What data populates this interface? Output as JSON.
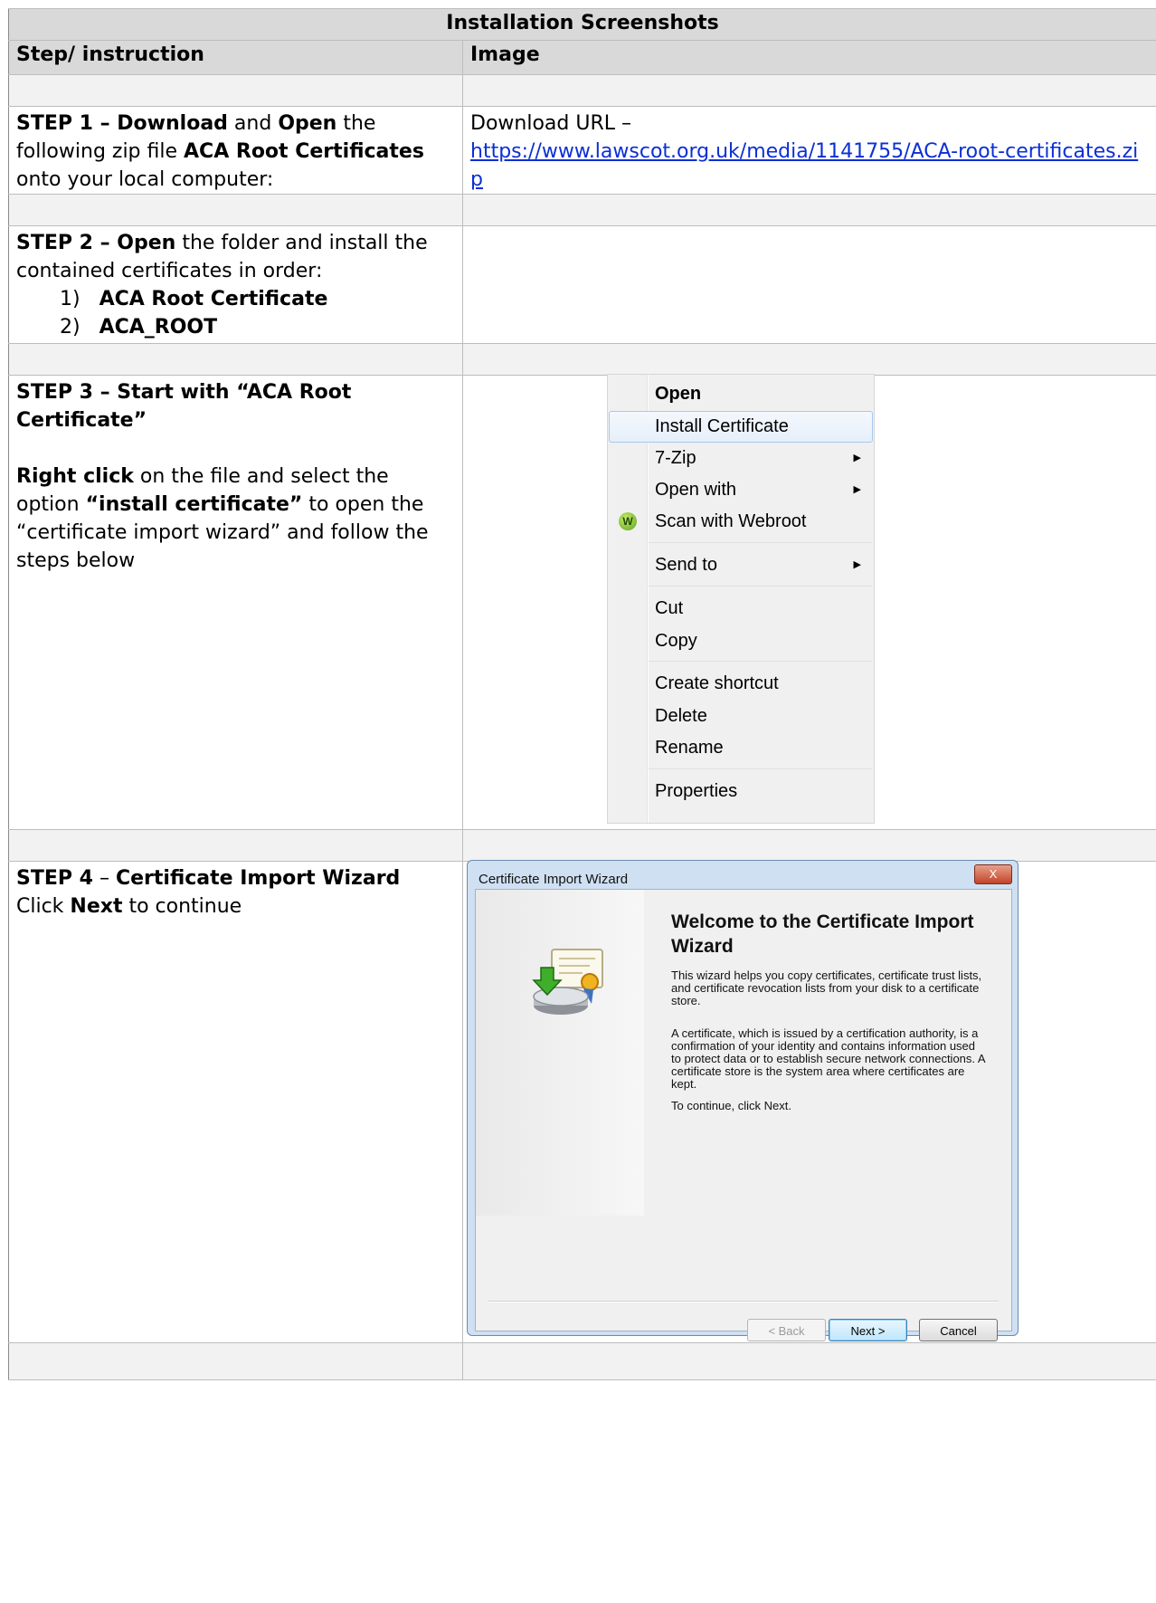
{
  "table": {
    "title": "Installation Screenshots",
    "col_step": "Step/ instruction",
    "col_image": "Image"
  },
  "step1": {
    "label": "STEP 1 – ",
    "download": "Download",
    "and": " and ",
    "open": "Open",
    "text1": " the following zip file ",
    "file": "ACA Root Certificates",
    "text2": " onto your local computer:",
    "url_label": "Download URL –",
    "url": "https://www.lawscot.org.uk/media/1141755/ACA-root-certificates.zip"
  },
  "step2": {
    "label": "STEP 2 – ",
    "open": "Open",
    "text": " the folder and install the contained certificates in order:",
    "items": [
      {
        "num": "1)",
        "name": "ACA Root Certificate"
      },
      {
        "num": "2)",
        "name": "ACA_ROOT"
      }
    ]
  },
  "step3": {
    "heading": "STEP 3 – Start with “ACA Root Certificate”",
    "right_click": "Right click",
    "text1": " on the file and select the option ",
    "option": "“install certificate”",
    "text2": " to open the “certificate import wizard” and follow the steps below"
  },
  "context_menu": {
    "items": [
      "Open",
      "Install Certificate",
      "7-Zip",
      "Open with",
      "Scan with Webroot",
      "Send to",
      "Cut",
      "Copy",
      "Create shortcut",
      "Delete",
      "Rename",
      "Properties"
    ],
    "webroot_icon": "W"
  },
  "step4": {
    "label": "STEP 4",
    "dash": " – ",
    "title": "Certificate Import Wizard",
    "click": "Click ",
    "next": "Next",
    "cont": " to continue"
  },
  "wizard": {
    "window_title": "Certificate Import Wizard",
    "close": "X",
    "heading": "Welcome to the Certificate Import Wizard",
    "para1": "This wizard helps you copy certificates, certificate trust lists, and certificate revocation lists from your disk to a certificate store.",
    "para2": "A certificate, which is issued by a certification authority, is a confirmation of your identity and contains information used to protect data or to establish secure network connections. A certificate store is the system area where certificates are kept.",
    "para3": "To continue, click Next.",
    "back": "< Back",
    "next": "Next >",
    "cancel": "Cancel"
  }
}
